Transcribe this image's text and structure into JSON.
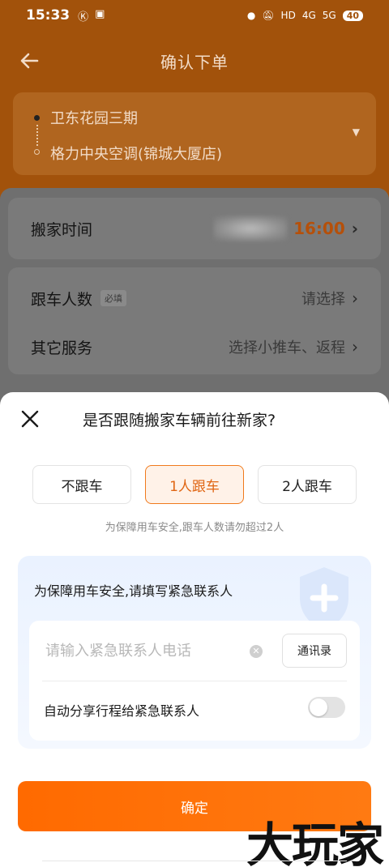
{
  "status_bar": {
    "time": "15:33",
    "network": "HD",
    "signal_1": "4G",
    "signal_2": "5G",
    "battery": "40"
  },
  "nav": {
    "title": "确认下单"
  },
  "route": {
    "from": "卫东花园三期",
    "to": "格力中央空调(锦城大厦店)"
  },
  "rows": {
    "move_time_label": "搬家时间",
    "move_time_value": "16:00",
    "riders_label": "跟车人数",
    "riders_required": "必填",
    "riders_value": "请选择",
    "other_label": "其它服务",
    "other_value": "选择小推车、返程"
  },
  "sheet": {
    "title": "是否跟随搬家车辆前往新家?",
    "options": [
      "不跟车",
      "1人跟车",
      "2人跟车"
    ],
    "selected_option": "1人跟车",
    "hint": "为保障用车安全,跟车人数请勿超过2人",
    "contact": {
      "title": "为保障用车安全,请填写紧急联系人",
      "phone_placeholder": "请输入紧急联系人电话",
      "phone_value": "",
      "contacts_button": "通讯录",
      "share_label": "自动分享行程给紧急联系人",
      "share_enabled": false
    },
    "confirm_label": "确定"
  },
  "watermark": "大玩家",
  "colors": {
    "accent": "#ff6a00",
    "selected_border": "#f07a1c",
    "selected_bg": "#fff2e8"
  }
}
